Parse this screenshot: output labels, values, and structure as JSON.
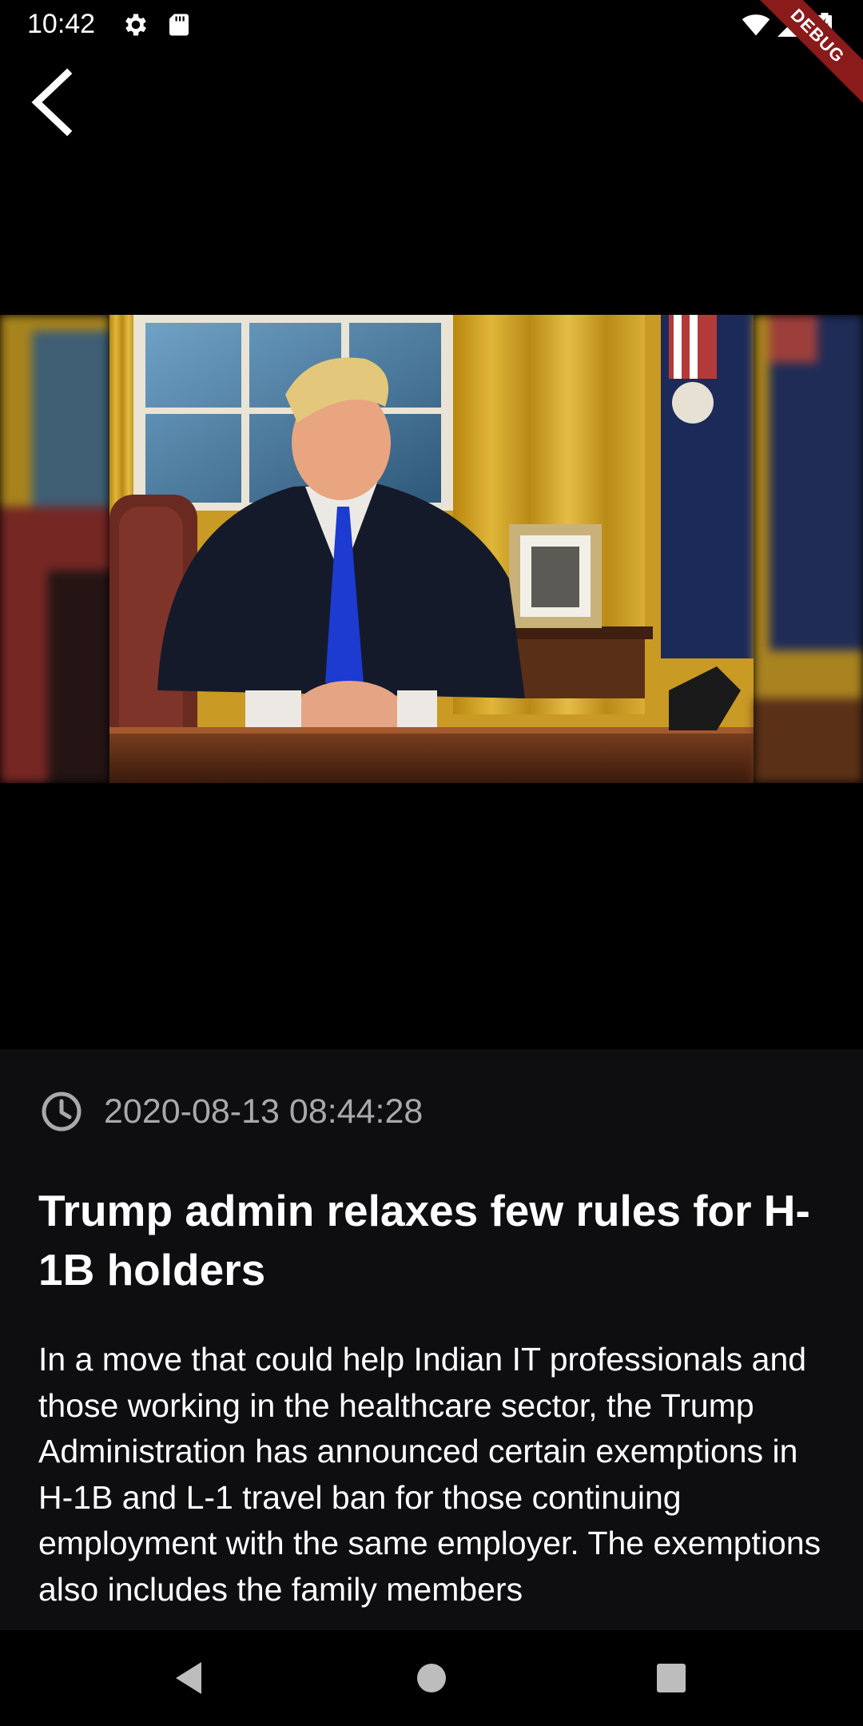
{
  "status_bar": {
    "time": "10:42",
    "icons": [
      "settings-gear-icon",
      "sd-card-icon",
      "wifi-icon",
      "signal-icon",
      "battery-charging-icon"
    ],
    "debug_label": "DEBUG"
  },
  "toolbar": {
    "back_icon": "chevron-left-icon"
  },
  "gallery": {
    "images": [
      "previous-photo",
      "main-photo",
      "next-photo"
    ]
  },
  "article": {
    "date_icon": "clock-icon",
    "date": "2020-08-13 08:44:28",
    "title": "Trump admin relaxes few rules for H-1B holders",
    "body": "In a move that could help Indian IT professionals and those working in the healthcare sector, the Trump Administration has announced certain exemptions in H-1B and L-1 travel ban for those continuing employment with the same employer. The exemptions also includes the family members"
  },
  "nav_bar": {
    "icons": [
      "back-triangle-icon",
      "home-circle-icon",
      "recents-square-icon"
    ]
  },
  "colors": {
    "background": "#000000",
    "panel": "#0e0e10",
    "muted_text": "#a9a9ad",
    "debug_banner": "#8b1a1a"
  }
}
